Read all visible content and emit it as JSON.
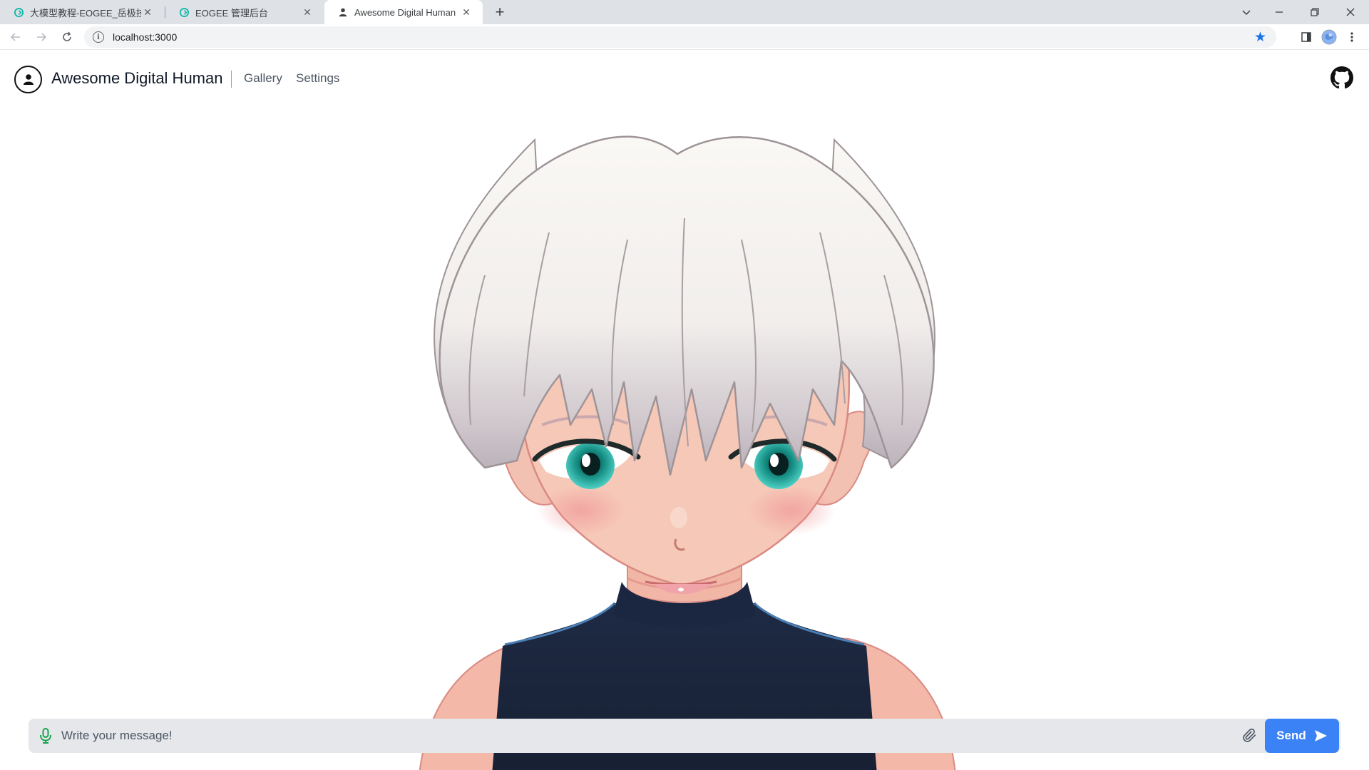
{
  "browser": {
    "tabs": [
      {
        "title": "大模型教程-EOGEE_岳极技术",
        "active": false
      },
      {
        "title": "EOGEE 管理后台",
        "active": false
      },
      {
        "title": "Awesome Digital Human",
        "active": true
      }
    ],
    "url": "localhost:3000"
  },
  "app": {
    "brand": "Awesome Digital Human",
    "nav": [
      "Gallery",
      "Settings"
    ]
  },
  "chat": {
    "placeholder": "Write your message!",
    "send_label": "Send"
  },
  "colors": {
    "accent": "#3b82f6",
    "mic": "#16a34a",
    "input_bg": "#e5e7eb"
  }
}
